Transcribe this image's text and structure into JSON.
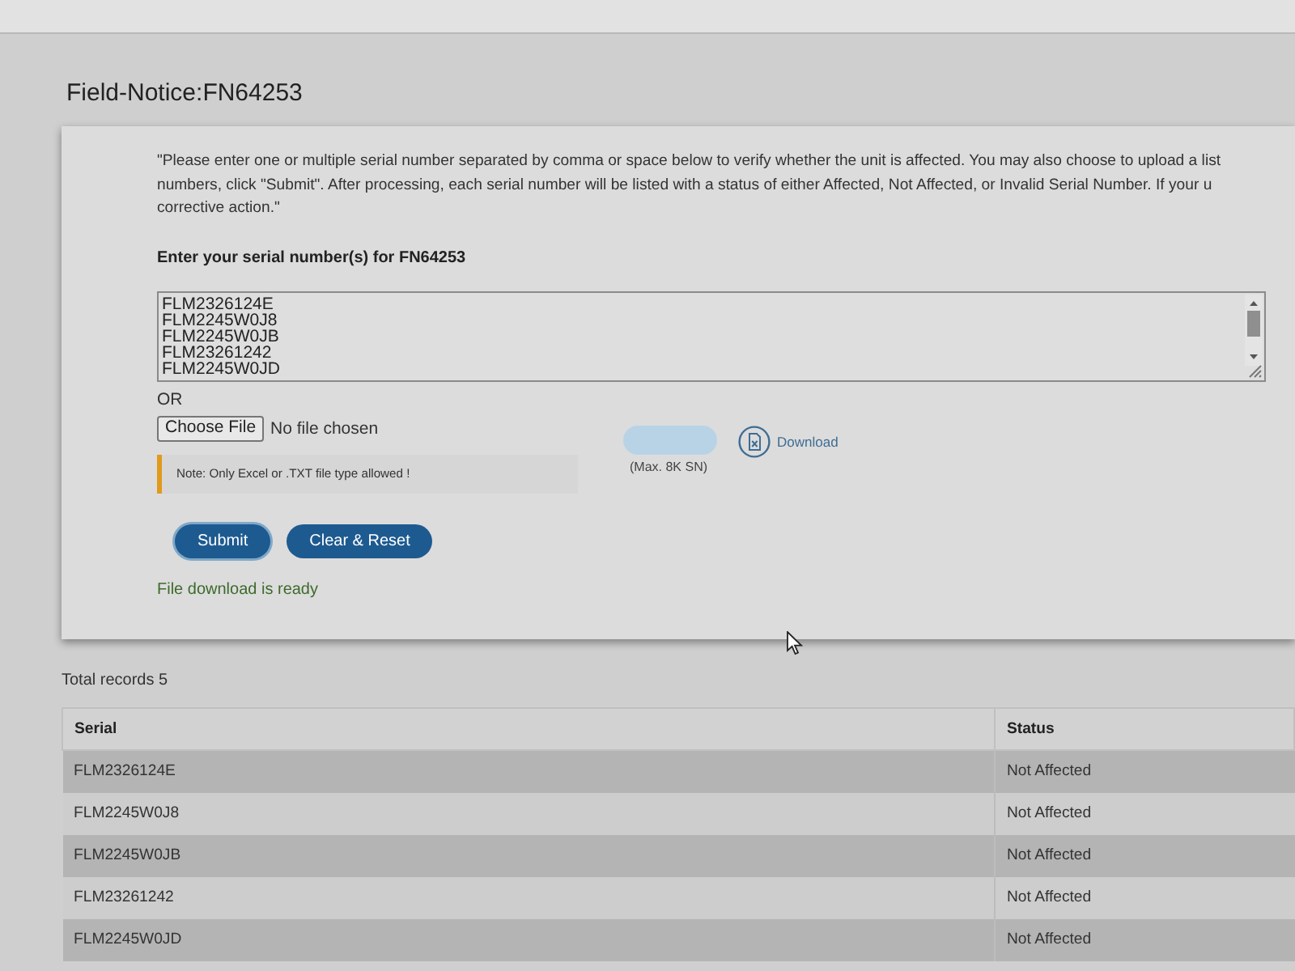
{
  "page_title": "Field-Notice:FN64253",
  "form": {
    "intro_lines": [
      "\"Please enter one or multiple serial number separated by comma or space below to verify whether the unit is affected. You may also choose to upload a list",
      "numbers, click \"Submit\". After processing, each serial number will be listed with a status of either Affected, Not Affected, or Invalid Serial Number. If your u",
      "corrective action.\""
    ],
    "serial_label": "Enter your serial number(s) for FN64253",
    "serial_input": {
      "value": "FLM2326124E\nFLM2245W0J8\nFLM2245W0JB\nFLM23261242\nFLM2245W0JD"
    },
    "or_label": "OR",
    "file_button": "Choose File",
    "file_status": "No file chosen",
    "note": "Note: Only Excel or .TXT file type allowed !",
    "faded_button": {
      "disabled": true
    },
    "max_hint": "(Max. 8K SN)",
    "download_link": "Download",
    "buttons": [
      {
        "label": "Submit",
        "focused": true
      },
      {
        "label": "Clear & Reset",
        "focused": false
      }
    ],
    "message": "File download is ready"
  },
  "results": {
    "total": "Total records 5",
    "columns": [
      "Serial",
      "Status"
    ],
    "rows": [
      [
        "FLM2326124E",
        "Not Affected"
      ],
      [
        "FLM2245W0J8",
        "Not Affected"
      ],
      [
        "FLM2245W0JB",
        "Not Affected"
      ],
      [
        "FLM23261242",
        "Not Affected"
      ],
      [
        "FLM2245W0JD",
        "Not Affected"
      ]
    ]
  }
}
